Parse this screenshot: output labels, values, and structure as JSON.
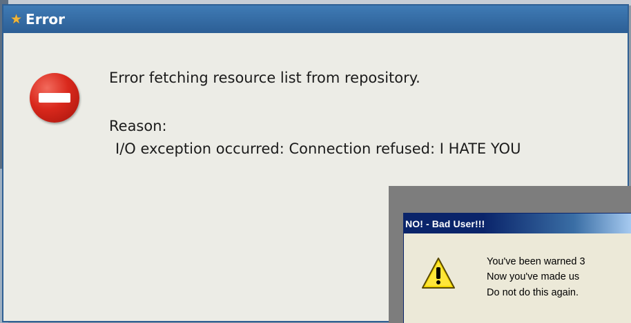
{
  "main_dialog": {
    "title": "Error",
    "message": "Error fetching resource list from repository.",
    "reason_label": "Reason:",
    "reason_detail": "I/O exception occurred: Connection refused: I HATE YOU",
    "title_icon": "star-icon",
    "message_icon": "stop-icon"
  },
  "overlay_dialog": {
    "title": "NO! - Bad User!!!",
    "icon": "warning-icon",
    "lines": [
      "You've been warned 3",
      "Now you've made us",
      "Do not do this again."
    ]
  },
  "colors": {
    "main_titlebar": "#2c5e95",
    "dialog_bg": "#ecece6",
    "stop_red": "#d9281c",
    "overlay_titlebar": "#0a246a",
    "warning_yellow": "#f5d800"
  }
}
